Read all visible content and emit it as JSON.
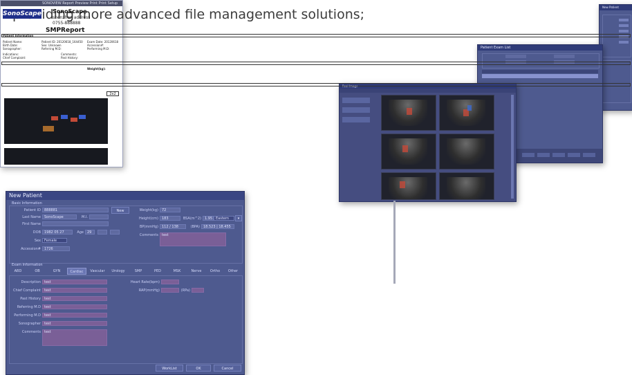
{
  "headline": {
    "line1": "",
    "line2": "providing more advanced file management solutions;"
  },
  "new_patient": {
    "title": "New Patient",
    "section_patient": "Basic Information",
    "patient_id_label": "Patient ID",
    "patient_id_value": "888881",
    "new_button": "New",
    "last_name_label": "Last Name",
    "last_name_value": "SonoScape",
    "mi_label": "M.I.",
    "first_name_label": "First Name",
    "dob_label": "DOB",
    "dob_value": "1982 05 27",
    "age_label": "Age",
    "age_value": "29",
    "sex_label": "Sex",
    "sex_value": "Female",
    "accession_label": "Accession#",
    "accession_value": "1726",
    "weight_label": "Weight(kg)",
    "weight_value": "72",
    "height_label": "Height(cm)",
    "height_value": "183",
    "bsa_label": "BSA(m^2)",
    "bsa_value": "1.95",
    "bsa_method": "Eastern",
    "bp_label": "BP(mmHg)",
    "bp_value": "112 / 138",
    "bpa_label": "(BPA)",
    "bpa_value": "18.523 | 18.455",
    "comments_label": "Comments",
    "comments_value": "test",
    "section_exam": "Exam Information",
    "tabs": [
      "ABD",
      "OB",
      "GYN",
      "Cardiac",
      "Vascular",
      "Urology",
      "SMP",
      "PED",
      "MSK",
      "Nerve",
      "Ortho",
      "Other"
    ],
    "description_label": "Description",
    "chief_complaint_label": "Chief Complaint",
    "past_history_label": "Past History",
    "referring_label": "Referring M.D",
    "performing_label": "Performing M.D",
    "sonographer_label": "Sonographer",
    "exam_comments_label": "Comments",
    "field_value": "test",
    "heart_rate_label": "Heart Rate(bpm)",
    "rap_label": "RAP(mmHg)",
    "rpa_label": "(RPa)",
    "worklist_button": "WorkList",
    "ok_button": "OK",
    "cancel_button": "Cancel"
  },
  "report": {
    "window_title": "SONOVIEW  Report  Preview  Print  Print Setup",
    "logo_text": "SonoScape",
    "company": "SonoScape",
    "address": "shenzhen address",
    "phone": "0755-888888",
    "report_title": "SMPReport",
    "patient_info": "Patient Information",
    "patient_name": "Patient Name:",
    "patient_id": "Patient ID: 20120618_164450",
    "exam_date": "Exam Date: 20120618",
    "birth_date": "Birth Date:",
    "sex": "Sex: Unknown",
    "accession": "Accession#:",
    "sonographer": "Sonographer:",
    "referring": "Referring M.D:",
    "performing": "Performing M.D:",
    "indications": "Indications:",
    "comments": "Comments:",
    "chief_complaint": "Chief Complaint:",
    "past_history": "Past History:",
    "weight": "Weight(kg):",
    "page_label": "2x2"
  },
  "image_review": {
    "title": "Real Image"
  },
  "exam_list": {
    "title": "Patient Exam List"
  },
  "new_patient_small": {
    "title": "New Patient"
  }
}
